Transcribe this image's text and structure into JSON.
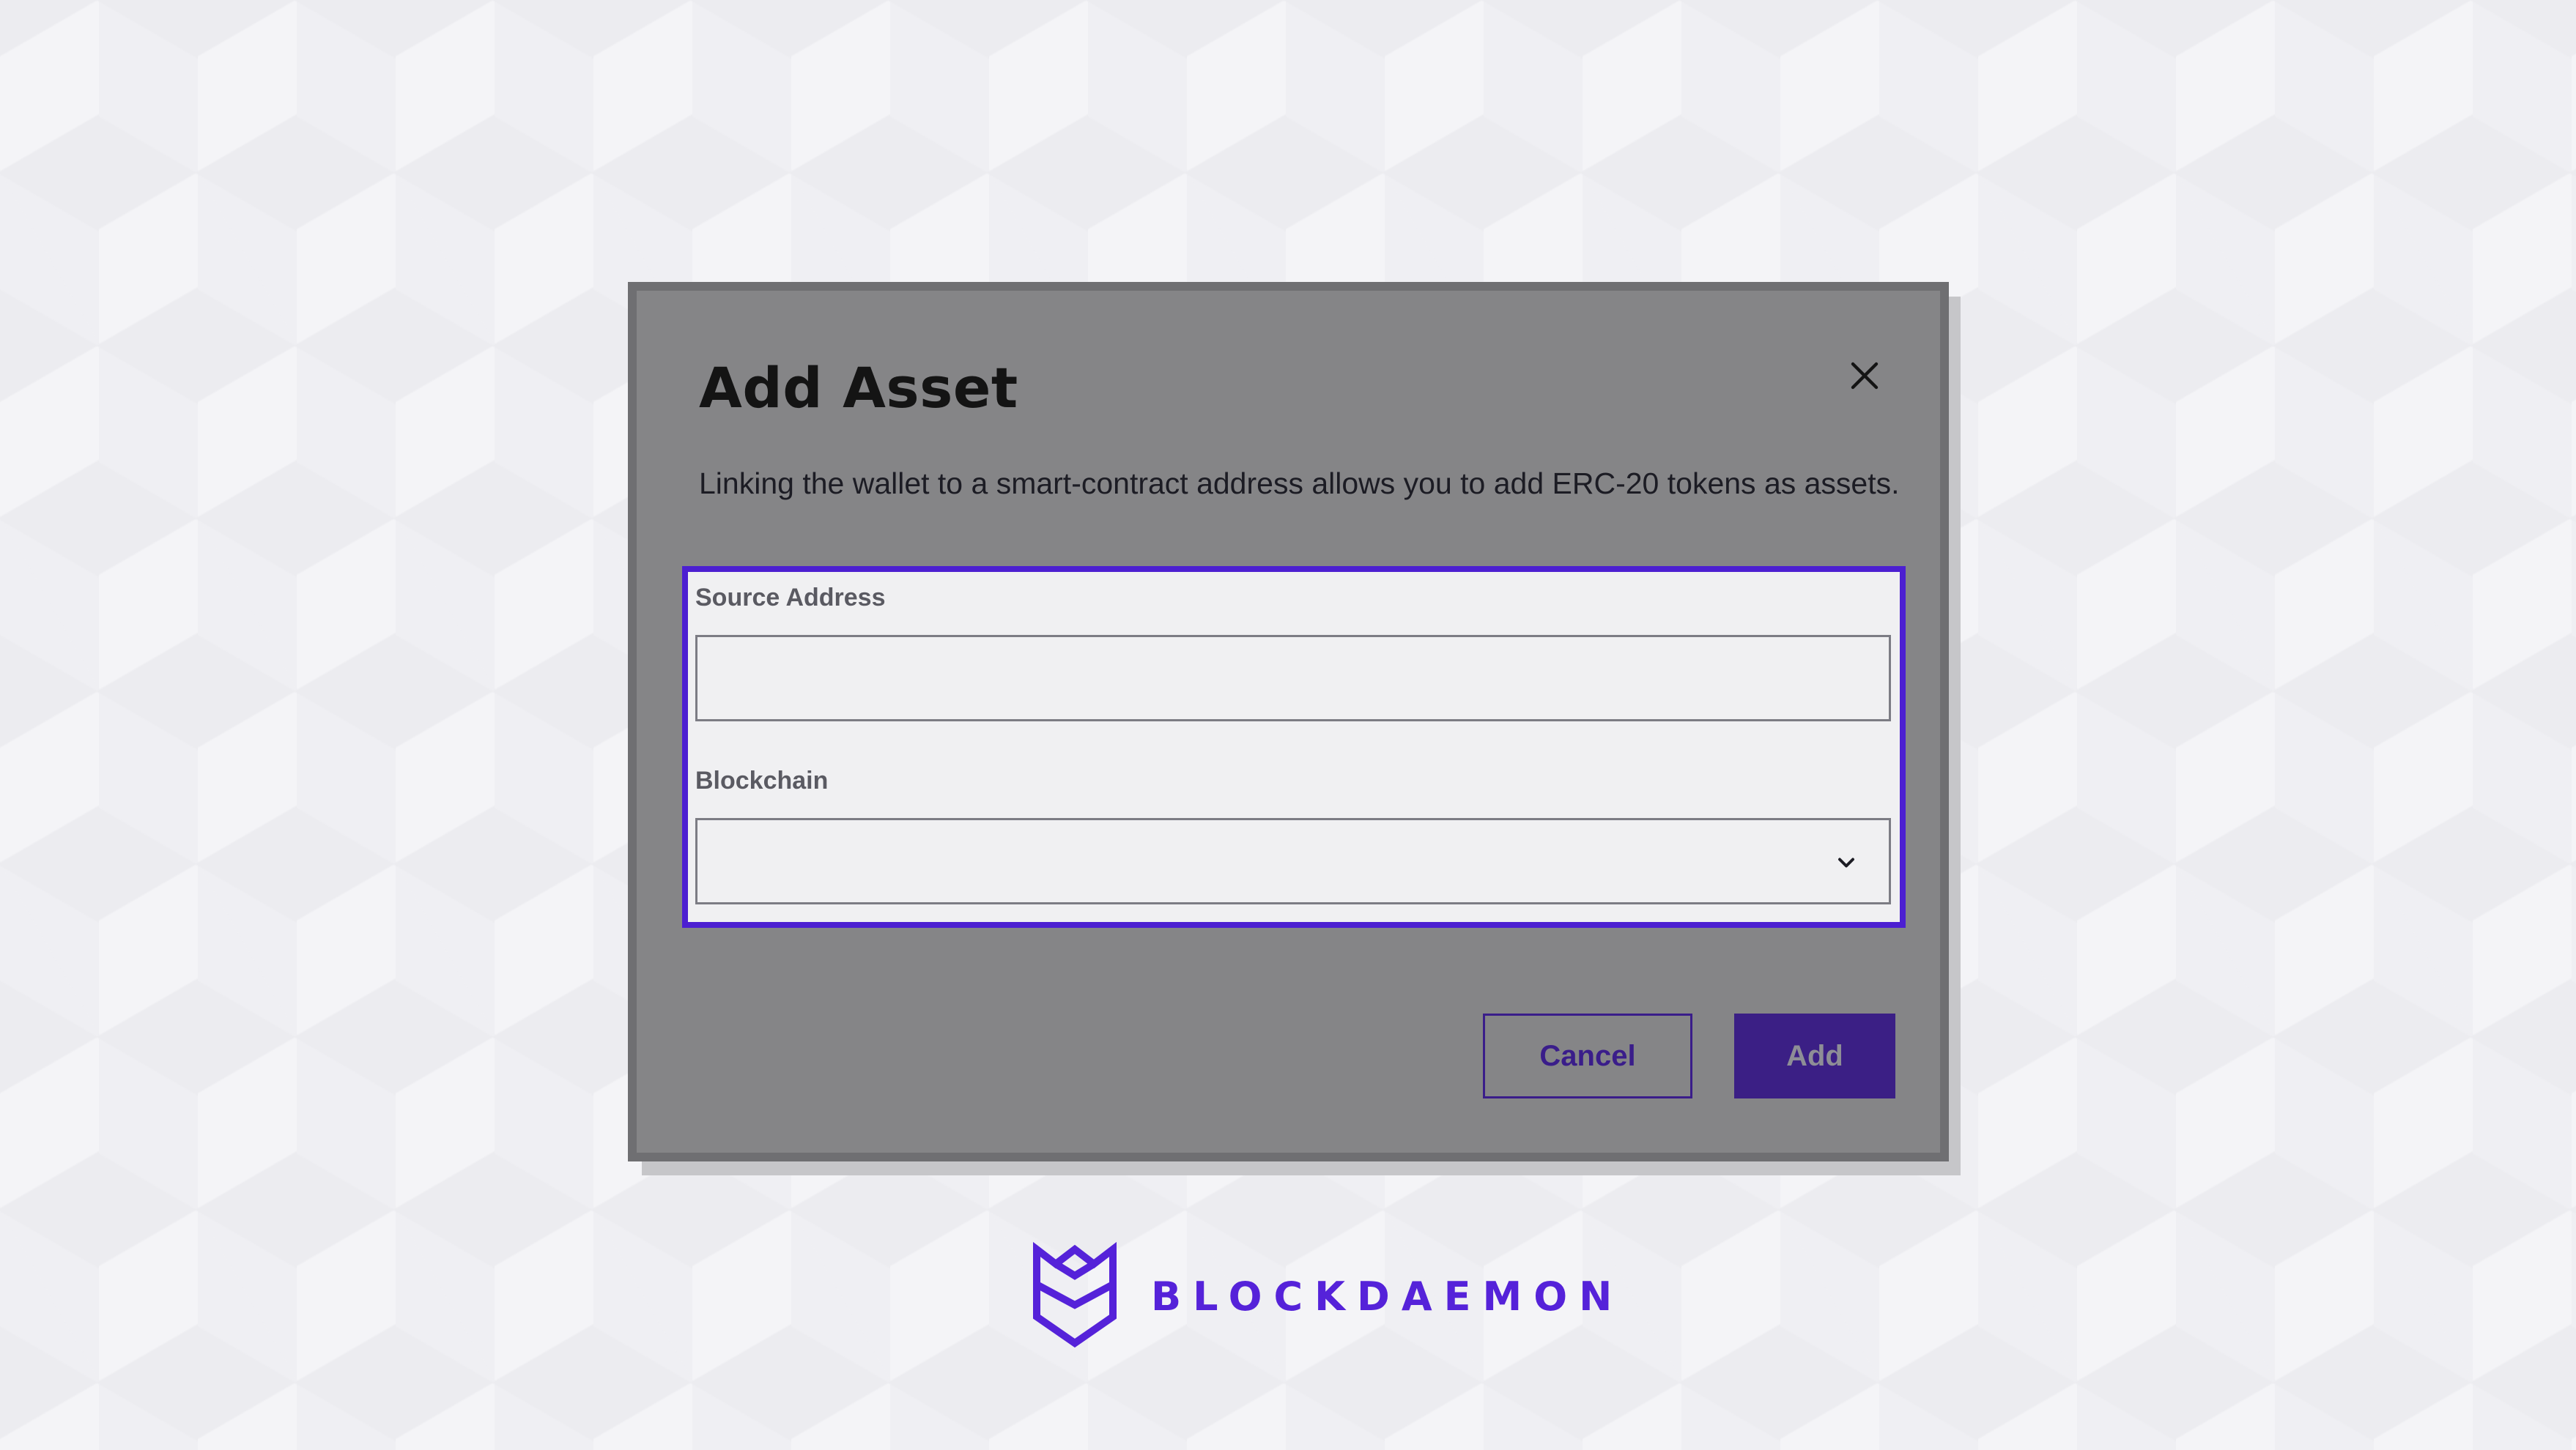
{
  "modal": {
    "title": "Add Asset",
    "description": "Linking the wallet to a smart-contract address allows you to add ERC-20 tokens as assets.",
    "close_icon": "close-icon"
  },
  "form": {
    "source_address": {
      "label": "Source Address",
      "value": "",
      "placeholder": ""
    },
    "blockchain": {
      "label": "Blockchain",
      "selected": "",
      "icon": "chevron-down-icon"
    }
  },
  "actions": {
    "cancel_label": "Cancel",
    "add_label": "Add"
  },
  "brand": {
    "name": "BLOCKDAEMON",
    "logo_icon": "blockdaemon-logo"
  },
  "colors": {
    "accent": "#4c1fd1",
    "brand": "#5522d9",
    "primary_button": "#3b1f85",
    "modal_overlay": "#858587"
  }
}
